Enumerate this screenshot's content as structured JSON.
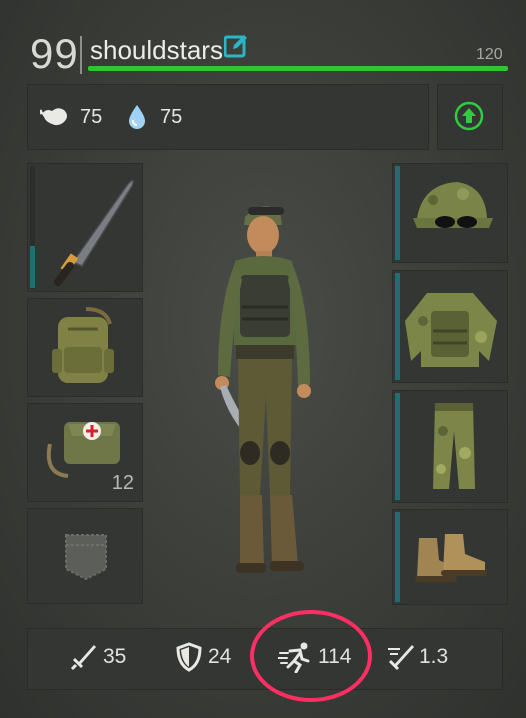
{
  "player": {
    "level": "99",
    "username": "shouldstars",
    "xp_max": "120"
  },
  "status": {
    "food": "75",
    "water": "75"
  },
  "slots": {
    "backpack_count": "12"
  },
  "stats": {
    "attack": "35",
    "defense": "24",
    "speed": "114",
    "attack_speed": "1.3"
  },
  "colors": {
    "xp": "#32c337",
    "durability": "#1e6e73",
    "highlight": "#ff2e63",
    "upgrade": "#2ecc40"
  },
  "icons": {
    "edit": "pencil-square-icon",
    "food": "stomach-icon",
    "water": "water-drop-icon",
    "upgrade": "arrow-up-circle-icon",
    "attack": "sword-icon",
    "defense": "shield-icon",
    "speed": "running-man-icon",
    "attack_speed": "fast-strike-icon"
  }
}
